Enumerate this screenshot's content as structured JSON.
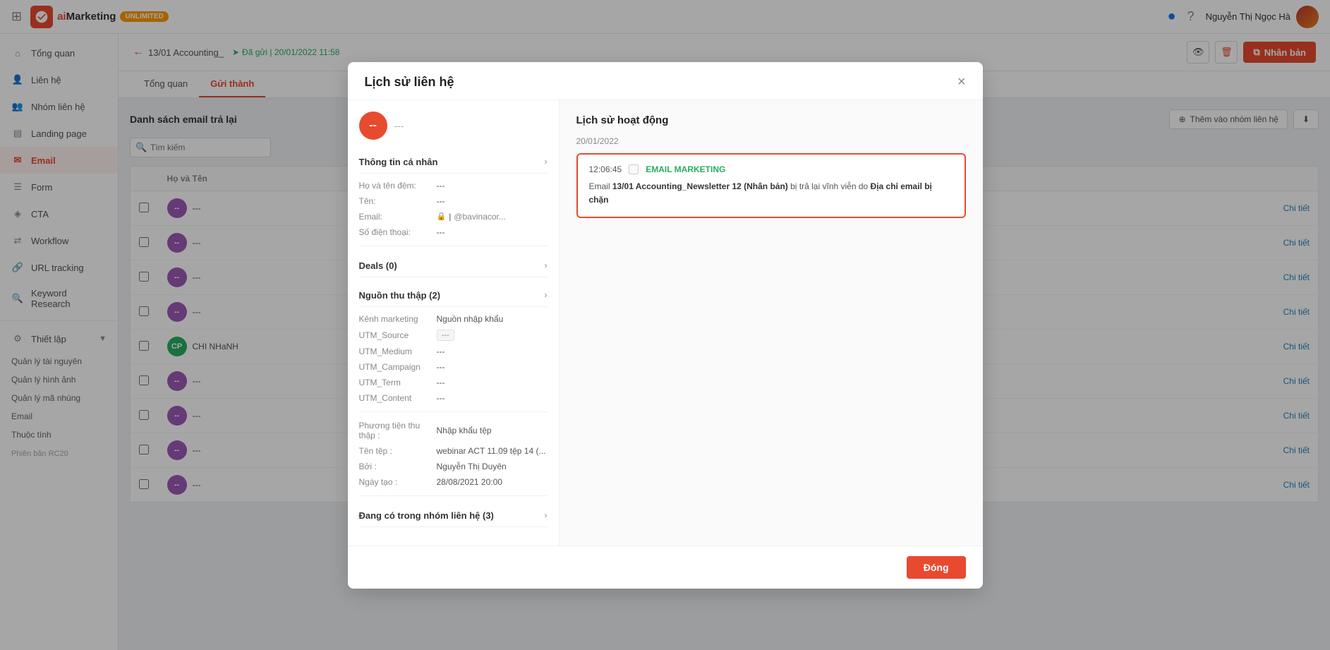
{
  "topbar": {
    "logo_text_ai": "ai",
    "logo_text_marketing": "Marketing",
    "badge_unlimited": "UNLIMITED",
    "fb_icon": "facebook",
    "help_icon": "question-mark",
    "user_name": "Nguyễn Thị Ngọc Hà",
    "grid_icon": "grid"
  },
  "sidebar": {
    "items": [
      {
        "id": "tong-quan",
        "label": "Tổng quan",
        "icon": "home",
        "active": false
      },
      {
        "id": "lien-he",
        "label": "Liên hệ",
        "icon": "user",
        "active": false
      },
      {
        "id": "nhom-lien-he",
        "label": "Nhóm liên hệ",
        "icon": "users",
        "active": false
      },
      {
        "id": "landing-page",
        "label": "Landing page",
        "icon": "layout",
        "active": false
      },
      {
        "id": "email",
        "label": "Email",
        "icon": "email",
        "active": true
      },
      {
        "id": "form",
        "label": "Form",
        "icon": "form",
        "active": false
      },
      {
        "id": "cta",
        "label": "CTA",
        "icon": "cta",
        "active": false
      },
      {
        "id": "workflow",
        "label": "Workflow",
        "icon": "workflow",
        "active": false
      },
      {
        "id": "url-tracking",
        "label": "URL tracking",
        "icon": "link",
        "active": false
      },
      {
        "id": "keyword-research",
        "label": "Keyword Research",
        "icon": "search",
        "active": false
      },
      {
        "id": "thiet-lap",
        "label": "Thiết lập",
        "icon": "settings",
        "active": false
      }
    ],
    "sub_items": [
      "Quản lý tài nguyên",
      "Quản lý hình ảnh",
      "Quản lý mã nhúng",
      "Email",
      "Thuộc tính"
    ],
    "version": "Phiên bản RC20"
  },
  "content_header": {
    "back_label": "13/01 Accounting_",
    "sent_label": "Đã gửi | 20/01/2022 11:58"
  },
  "tabs": [
    {
      "id": "tong-quan",
      "label": "Tổng quan"
    },
    {
      "id": "gui-thanh",
      "label": "Gửi thành"
    }
  ],
  "table": {
    "title": "Danh sách email trả lại",
    "search_placeholder": "Tìm kiếm",
    "btn_add_group": "Thêm vào nhóm liên hệ",
    "btn_export": "Xuất",
    "columns": [
      "",
      "Họ và Tên",
      "Chi tiết"
    ],
    "rows": [
      {
        "id": 1,
        "avatar_text": "--",
        "avatar_color": "purple",
        "name": "---",
        "detail": "Chi tiết"
      },
      {
        "id": 2,
        "avatar_text": "--",
        "avatar_color": "purple",
        "name": "---",
        "detail": "Chi tiết"
      },
      {
        "id": 3,
        "avatar_text": "--",
        "avatar_color": "purple",
        "name": "---",
        "detail": "Chi tiết"
      },
      {
        "id": 4,
        "avatar_text": "--",
        "avatar_color": "purple",
        "name": "---",
        "detail": "Chi tiết"
      },
      {
        "id": 5,
        "avatar_text": "CP",
        "avatar_color": "green",
        "name": "CHI NHaNH",
        "detail": "Chi tiết"
      },
      {
        "id": 6,
        "avatar_text": "--",
        "avatar_color": "purple",
        "name": "---",
        "detail": "Chi tiết"
      },
      {
        "id": 7,
        "avatar_text": "--",
        "avatar_color": "purple",
        "name": "---",
        "detail": "Chi tiết"
      },
      {
        "id": 8,
        "avatar_text": "--",
        "avatar_color": "purple",
        "name": "---",
        "detail": "Chi tiết"
      },
      {
        "id": 9,
        "avatar_text": "--",
        "avatar_color": "purple",
        "name": "---",
        "detail": "Chi tiết"
      }
    ]
  },
  "top_right_btns": {
    "eye_icon": "eye",
    "delete_icon": "trash",
    "publish_label": "Nhân bản"
  },
  "modal": {
    "title": "Lịch sử liên hệ",
    "close_icon": "×",
    "left_panel": {
      "contact_avatar_text": "--",
      "contact_name": "---",
      "personal_info": {
        "section_title": "Thông tin cá nhân",
        "fields": [
          {
            "label": "Họ và tên đệm:",
            "value": "---"
          },
          {
            "label": "Tên:",
            "value": "---"
          },
          {
            "label": "Email:",
            "value": "| @bavinacor..."
          },
          {
            "label": "Số điện thoại:",
            "value": "---"
          }
        ]
      },
      "deals": {
        "section_title": "Deals (0)"
      },
      "sources": {
        "section_title": "Nguồn thu thập (2)",
        "fields": [
          {
            "label": "Kênh marketing",
            "value": "Nguồn nhập khẩu"
          },
          {
            "label": "UTM_Source",
            "value": "---",
            "is_badge": true
          },
          {
            "label": "UTM_Medium",
            "value": "---"
          },
          {
            "label": "UTM_Campaign",
            "value": "---"
          },
          {
            "label": "UTM_Term",
            "value": "---"
          },
          {
            "label": "UTM_Content",
            "value": "---"
          }
        ],
        "method_label": "Phương tiện thu thập :",
        "method_value": "Nhập khẩu tệp",
        "file_label": "Tên tệp :",
        "file_value": "webinar ACT 11.09 tệp 14 (...",
        "by_label": "Bởi :",
        "by_value": "Nguyễn Thị Duyên",
        "date_label": "Ngày tạo :",
        "date_value": "28/08/2021 20:00"
      },
      "groups": {
        "section_title": "Đang có trong nhóm liên hệ (3)"
      }
    },
    "right_panel": {
      "title": "Lịch sử hoạt động",
      "date": "20/01/2022",
      "activity": {
        "time": "12:06:45",
        "type": "EMAIL MARKETING",
        "description_parts": [
          "Email ",
          "13/01 Accounting_Newsletter 12 (Nhân bản)",
          " bị trả lại vĩnh viễn do ",
          "Địa chỉ email bị chặn"
        ]
      }
    },
    "footer": {
      "close_btn_label": "Đóng"
    }
  }
}
